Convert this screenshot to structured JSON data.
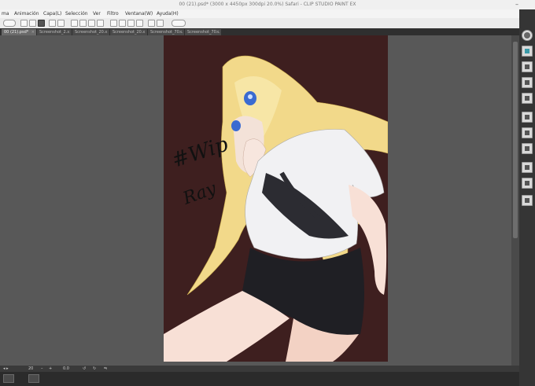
{
  "window": {
    "title": "00 (21).psd* (3000 x 4450px 300dpi 20.0%)  Safari - CLIP STUDIO PAINT EX",
    "minimize": "–"
  },
  "menu": {
    "items": [
      {
        "label": "ma"
      },
      {
        "label": "Animación"
      },
      {
        "label": "Capa(L)"
      },
      {
        "label": "Selección"
      },
      {
        "label": "Ver"
      },
      {
        "label": "Filtro"
      },
      {
        "label": "Ventana(W)"
      },
      {
        "label": "Ayuda(H)"
      }
    ]
  },
  "tabs": [
    {
      "label": "00 (21).psd*",
      "active": true
    },
    {
      "label": "Screenshot_2...",
      "active": false
    },
    {
      "label": "Screenshot_20...",
      "active": false
    },
    {
      "label": "Screenshot_20...",
      "active": false
    },
    {
      "label": "Screenshot_70...",
      "active": false
    },
    {
      "label": "Screenshot_70...",
      "active": false
    },
    {
      "label": "Screenshot_75...",
      "active": false
    }
  ],
  "canvas": {
    "wip_text": "#Wip",
    "signature": "Ray",
    "background_color": "#3e1f1f"
  },
  "status": {
    "zoom": "20",
    "rotation": "0.0"
  },
  "right_panel": {
    "icons": [
      "navigator-icon",
      "close-icon",
      "layer-icon",
      "layer-icon",
      "layer-icon",
      "layer-icon",
      "layer-icon",
      "layer-icon",
      "layer-icon",
      "layer-icon"
    ]
  }
}
